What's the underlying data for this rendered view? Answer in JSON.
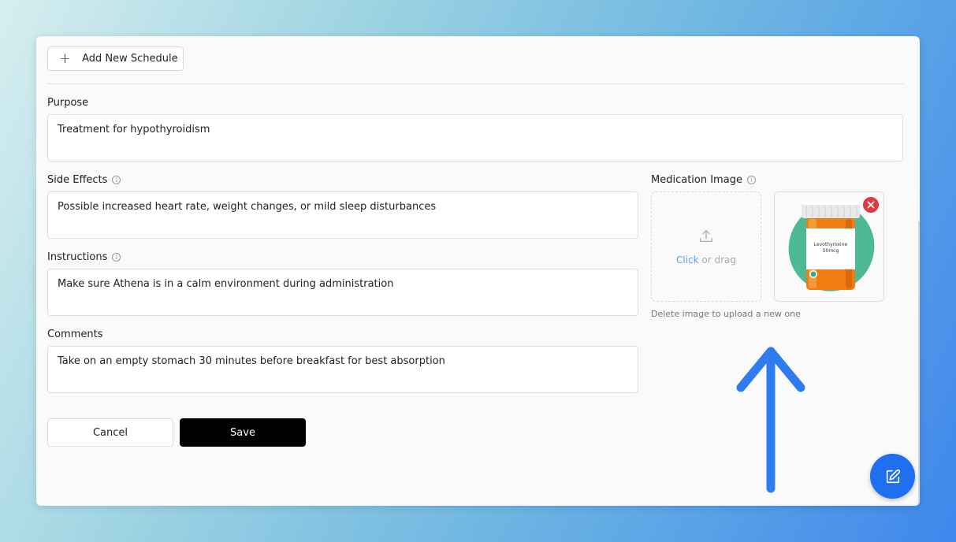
{
  "toolbar": {
    "add_schedule_label": "Add New Schedule"
  },
  "purpose": {
    "label": "Purpose",
    "value": "Treatment for hypothyroidism"
  },
  "side_effects": {
    "label": "Side Effects",
    "value": "Possible increased heart rate, weight changes, or mild sleep disturbances"
  },
  "instructions": {
    "label": "Instructions",
    "value": "Make sure Athena is in a calm environment during administration"
  },
  "comments": {
    "label": "Comments",
    "value": "Take on an empty stomach 30 minutes before breakfast for best absorption"
  },
  "medication_image": {
    "label": "Medication Image",
    "upload_click": "Click",
    "upload_or_drag": "or drag",
    "bottle_label_line1": "Levothyroxine",
    "bottle_label_line2": "50mcg",
    "hint": "Delete image to upload a new one"
  },
  "actions": {
    "cancel_label": "Cancel",
    "save_label": "Save"
  },
  "icons": {
    "add": "plus-icon",
    "info": "info-icon",
    "upload": "upload-icon",
    "remove": "close-icon",
    "edit": "edit-icon",
    "annotation_arrow": "arrow-up-icon"
  },
  "colors": {
    "primary_button": "#000000",
    "remove_button": "#e0393e",
    "fab": "#1f6ff0",
    "annotation_arrow": "#2f7bf0",
    "link": "#5b9bf0"
  }
}
